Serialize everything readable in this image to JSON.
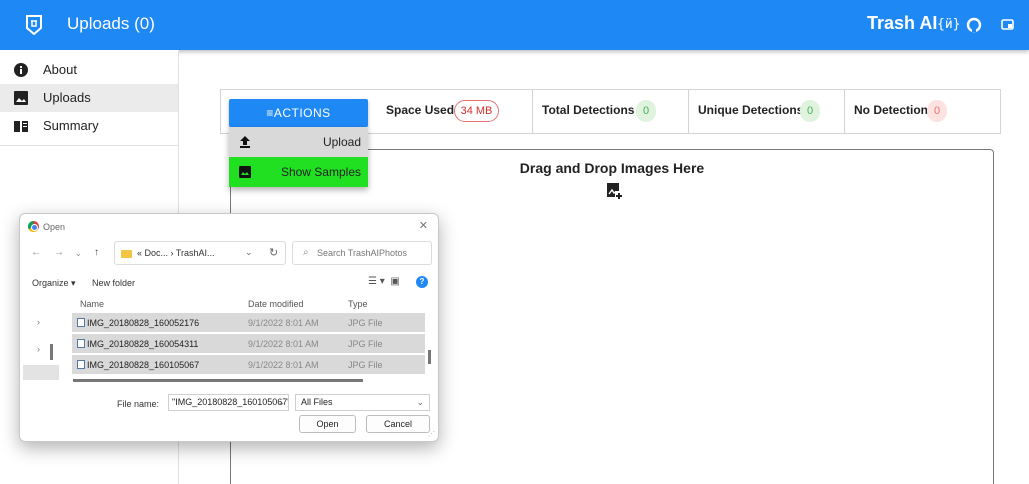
{
  "appbar": {
    "title": "Uploads (0)",
    "brand": "Trash AI",
    "icons": [
      "logo-icon",
      "braces-icon",
      "github-icon",
      "window-icon"
    ],
    "color": "#1e88f5"
  },
  "sidebar": {
    "items": [
      {
        "label": "About",
        "icon": "info-icon"
      },
      {
        "label": "Uploads",
        "icon": "image-icon",
        "active": true
      },
      {
        "label": "Summary",
        "icon": "book-icon"
      }
    ]
  },
  "stats": {
    "space_used": {
      "label": "Space Used",
      "value": "34 MB"
    },
    "total_detections": {
      "label": "Total Detections",
      "value": "0"
    },
    "unique_detections": {
      "label": "Unique Detections",
      "value": "0"
    },
    "no_detections": {
      "label": "No Detections",
      "value": "0"
    }
  },
  "actions": {
    "button_label": "ACTIONS",
    "menu": [
      {
        "label": "Upload",
        "icon": "upload-icon",
        "background": "#d9d9d9"
      },
      {
        "label": "Show Samples",
        "icon": "image-icon",
        "background": "#21e021"
      }
    ]
  },
  "dropzone": {
    "title": "Drag and Drop Images Here",
    "icon": "image-add-icon"
  },
  "dialog": {
    "title": "Open",
    "close": "✕",
    "address_path": "« Doc... › TrashAI...",
    "search_placeholder": "Search TrashAIPhotos",
    "organize": "Organize ▾",
    "new_folder": "New folder",
    "columns": {
      "name": "Name",
      "date": "Date modified",
      "type": "Type"
    },
    "files": [
      {
        "name": "IMG_20180828_160052176",
        "date": "9/1/2022 8:01 AM",
        "type": "JPG File"
      },
      {
        "name": "IMG_20180828_160054311",
        "date": "9/1/2022 8:01 AM",
        "type": "JPG File"
      },
      {
        "name": "IMG_20180828_160105067",
        "date": "9/1/2022 8:01 AM",
        "type": "JPG File"
      }
    ],
    "file_name_label": "File name:",
    "file_name_value": "\"IMG_20180828_160105067\" \"IMG_2C",
    "file_type": "All Files",
    "open_button": "Open",
    "cancel_button": "Cancel"
  }
}
